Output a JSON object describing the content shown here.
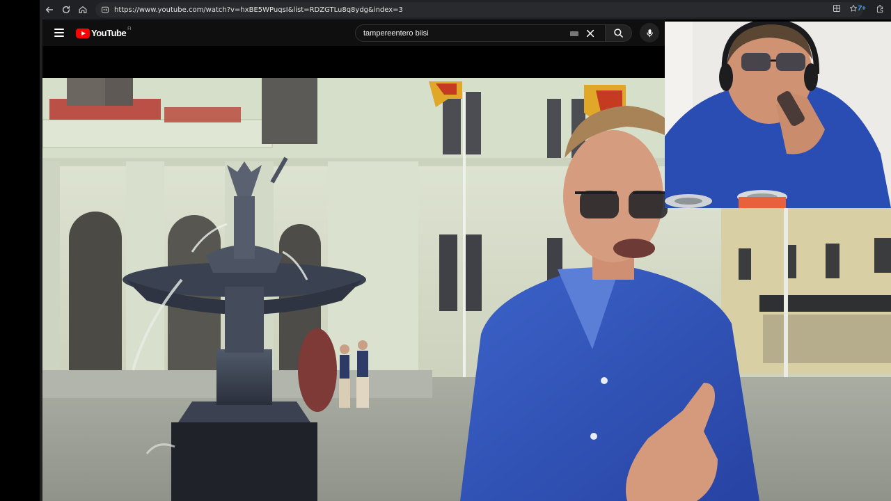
{
  "browser": {
    "url": "https://www.youtube.com/watch?v=hxBE5WPuqsI&list=RDZGTLu8q8ydg&index=3",
    "icons": [
      "back-icon",
      "reload-icon",
      "home-icon",
      "site-info-icon",
      "split-view-icon",
      "bookmark-star-icon",
      "extension-icon",
      "extensions-puzzle-icon"
    ],
    "extension_label": "7+"
  },
  "youtube": {
    "logo_text": "YouTube",
    "region": "FI",
    "search_value": "tampereentero biisi",
    "accent_color": "#ff0000"
  }
}
